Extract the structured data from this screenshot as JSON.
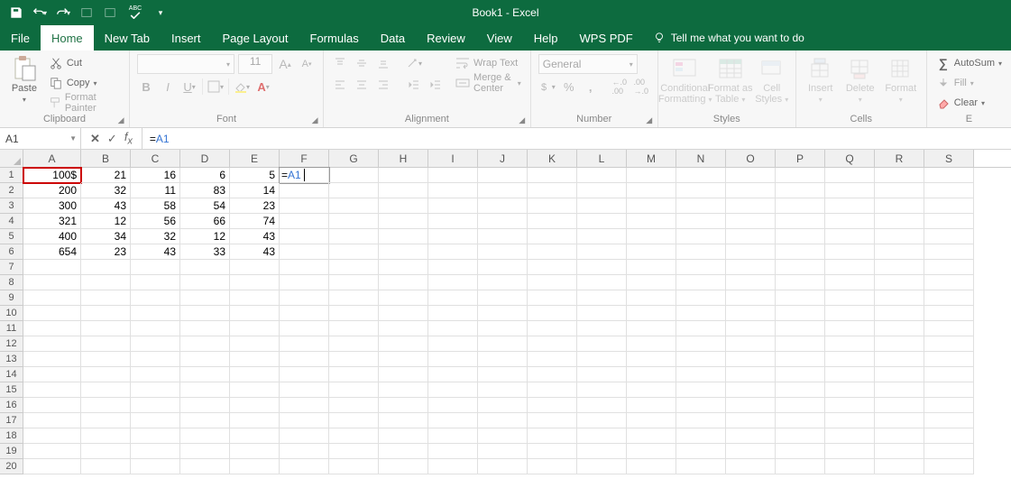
{
  "title": "Book1 - Excel",
  "qat": {
    "save": "save-icon",
    "undo": "undo-icon",
    "redo": "redo-icon",
    "disabled1": "qat-icon",
    "disabled2": "qat-icon",
    "spell": "spelling-icon",
    "spell_text": "ABC"
  },
  "tabs": {
    "file": "File",
    "home": "Home",
    "newtab": "New Tab",
    "insert": "Insert",
    "pagelayout": "Page Layout",
    "formulas": "Formulas",
    "data": "Data",
    "review": "Review",
    "view": "View",
    "help": "Help",
    "wpspdf": "WPS PDF",
    "tellme": "Tell me what you want to do"
  },
  "ribbon": {
    "clipboard": {
      "label": "Clipboard",
      "paste": "Paste",
      "cut": "Cut",
      "copy": "Copy",
      "format_painter": "Format Painter"
    },
    "font": {
      "label": "Font",
      "size": "11",
      "bold": "B",
      "italic": "I",
      "underline": "U",
      "inc": "A",
      "dec": "A"
    },
    "alignment": {
      "label": "Alignment",
      "wrap": "Wrap Text",
      "merge": "Merge & Center"
    },
    "number": {
      "label": "Number",
      "format": "General",
      "currency": "$",
      "percent": "%",
      "comma": ",",
      "inc": ".00",
      "dec": ".0"
    },
    "styles": {
      "label": "Styles",
      "cond": "Conditional",
      "cond2": "Formatting",
      "table": "Format as",
      "table2": "Table",
      "cell": "Cell",
      "cell2": "Styles"
    },
    "cells": {
      "label": "Cells",
      "insert": "Insert",
      "delete": "Delete",
      "format": "Format"
    },
    "editing": {
      "label": "E",
      "autosum": "AutoSum",
      "fill": "Fill",
      "clear": "Clear"
    }
  },
  "formula_bar": {
    "name": "A1",
    "formula_eq": "=",
    "formula_ref": "A1"
  },
  "columns": [
    "A",
    "B",
    "C",
    "D",
    "E",
    "F",
    "G",
    "H",
    "I",
    "J",
    "K",
    "L",
    "M",
    "N",
    "O",
    "P",
    "Q",
    "R",
    "S"
  ],
  "rowcount": 20,
  "cells": {
    "r1": {
      "A": "100$",
      "B": "21",
      "C": "16",
      "D": "6",
      "E": "5",
      "F_eq": "=",
      "F_ref": "A1"
    },
    "r2": {
      "A": "200",
      "B": "32",
      "C": "11",
      "D": "83",
      "E": "14"
    },
    "r3": {
      "A": "300",
      "B": "43",
      "C": "58",
      "D": "54",
      "E": "23"
    },
    "r4": {
      "A": "321",
      "B": "12",
      "C": "56",
      "D": "66",
      "E": "74"
    },
    "r5": {
      "A": "400",
      "B": "34",
      "C": "32",
      "D": "12",
      "E": "43"
    },
    "r6": {
      "A": "654",
      "B": "23",
      "C": "43",
      "D": "33",
      "E": "43"
    }
  },
  "active_cell": "F1",
  "reference_cell": "A1"
}
